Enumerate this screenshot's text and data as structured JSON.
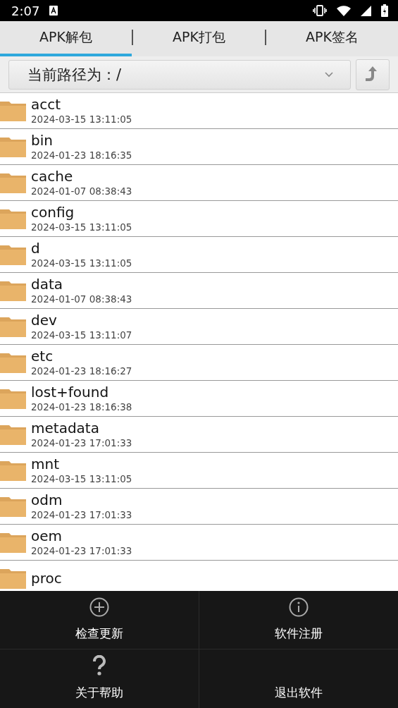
{
  "status_bar": {
    "time": "2:07"
  },
  "tabs": [
    {
      "label": "APK解包",
      "selected": true
    },
    {
      "label": "APK打包",
      "selected": false
    },
    {
      "label": "APK签名",
      "selected": false
    }
  ],
  "path_selector": {
    "value": "当前路径为：/"
  },
  "files": [
    {
      "name": "acct",
      "date": "2024-03-15 13:11:05"
    },
    {
      "name": "bin",
      "date": "2024-01-23 18:16:35"
    },
    {
      "name": "cache",
      "date": "2024-01-07 08:38:43"
    },
    {
      "name": "config",
      "date": "2024-03-15 13:11:05"
    },
    {
      "name": "d",
      "date": "2024-03-15 13:11:05"
    },
    {
      "name": "data",
      "date": "2024-01-07 08:38:43"
    },
    {
      "name": "dev",
      "date": "2024-03-15 13:11:07"
    },
    {
      "name": "etc",
      "date": "2024-01-23 18:16:27"
    },
    {
      "name": "lost+found",
      "date": "2024-01-23 18:16:38"
    },
    {
      "name": "metadata",
      "date": "2024-01-23 17:01:33"
    },
    {
      "name": "mnt",
      "date": "2024-03-15 13:11:05"
    },
    {
      "name": "odm",
      "date": "2024-01-23 17:01:33"
    },
    {
      "name": "oem",
      "date": "2024-01-23 17:01:33"
    },
    {
      "name": "proc"
    }
  ],
  "menu": [
    {
      "label": "检查更新"
    },
    {
      "label": "软件注册"
    },
    {
      "label": "关于帮助"
    },
    {
      "label": "退出软件"
    }
  ]
}
